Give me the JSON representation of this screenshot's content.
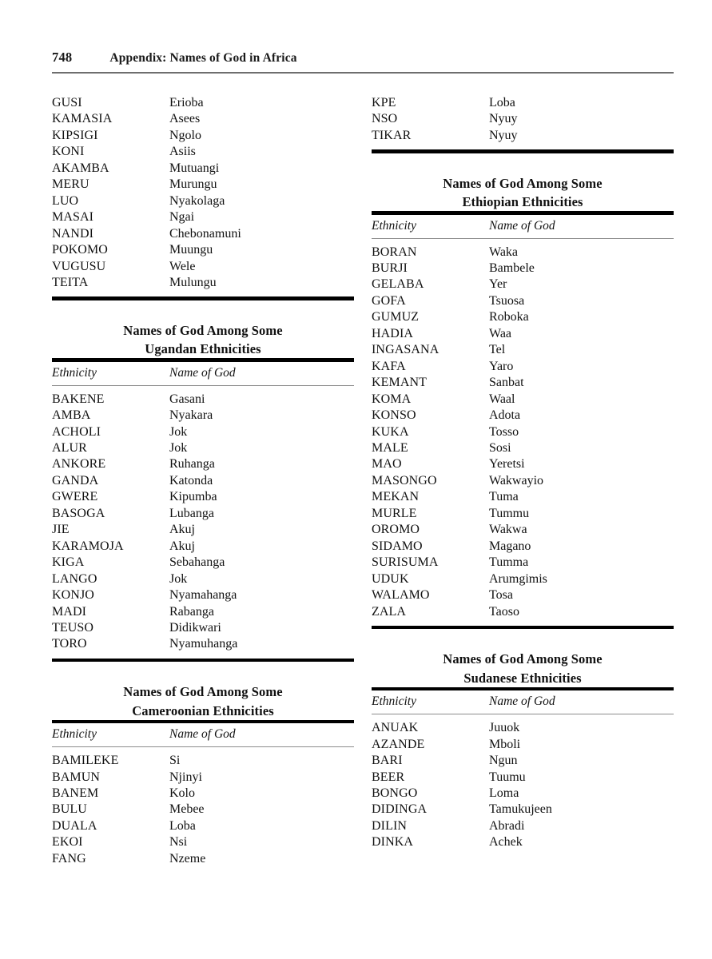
{
  "header": {
    "folio": "748",
    "title": "Appendix: Names of God in Africa"
  },
  "columns": {
    "left": [
      {
        "id": "kenyan-continued",
        "has_title": false,
        "has_column_headers": false,
        "closing_rule": true,
        "rows": [
          {
            "ethnicity": "GUSI",
            "name_of_god": "Erioba"
          },
          {
            "ethnicity": "KAMASIA",
            "name_of_god": "Asees"
          },
          {
            "ethnicity": "KIPSIGI",
            "name_of_god": "Ngolo"
          },
          {
            "ethnicity": "KONI",
            "name_of_god": "Asiis"
          },
          {
            "ethnicity": "AKAMBA",
            "name_of_god": "Mutuangi"
          },
          {
            "ethnicity": "MERU",
            "name_of_god": "Murungu"
          },
          {
            "ethnicity": "LUO",
            "name_of_god": "Nyakolaga"
          },
          {
            "ethnicity": "MASAI",
            "name_of_god": "Ngai"
          },
          {
            "ethnicity": "NANDI",
            "name_of_god": "Chebonamuni"
          },
          {
            "ethnicity": "POKOMO",
            "name_of_god": "Muungu"
          },
          {
            "ethnicity": "VUGUSU",
            "name_of_god": "Wele"
          },
          {
            "ethnicity": "TEITA",
            "name_of_god": "Mulungu"
          }
        ]
      },
      {
        "id": "ugandan",
        "has_title": true,
        "title_line1": "Names of God Among Some",
        "title_line2": "Ugandan Ethnicities",
        "has_column_headers": true,
        "header_ethnicity": "Ethnicity",
        "header_name_of_god": "Name of God",
        "closing_rule": true,
        "rows": [
          {
            "ethnicity": "BAKENE",
            "name_of_god": "Gasani"
          },
          {
            "ethnicity": "AMBA",
            "name_of_god": "Nyakara"
          },
          {
            "ethnicity": "ACHOLI",
            "name_of_god": "Jok"
          },
          {
            "ethnicity": "ALUR",
            "name_of_god": "Jok"
          },
          {
            "ethnicity": "ANKORE",
            "name_of_god": "Ruhanga"
          },
          {
            "ethnicity": "GANDA",
            "name_of_god": "Katonda"
          },
          {
            "ethnicity": "GWERE",
            "name_of_god": "Kipumba"
          },
          {
            "ethnicity": "BASOGA",
            "name_of_god": "Lubanga"
          },
          {
            "ethnicity": "JIE",
            "name_of_god": "Akuj"
          },
          {
            "ethnicity": "KARAMOJA",
            "name_of_god": "Akuj"
          },
          {
            "ethnicity": "KIGA",
            "name_of_god": "Sebahanga"
          },
          {
            "ethnicity": "LANGO",
            "name_of_god": "Jok"
          },
          {
            "ethnicity": "KONJO",
            "name_of_god": "Nyamahanga"
          },
          {
            "ethnicity": "MADI",
            "name_of_god": "Rabanga"
          },
          {
            "ethnicity": "TEUSO",
            "name_of_god": "Didikwari"
          },
          {
            "ethnicity": "TORO",
            "name_of_god": "Nyamuhanga"
          }
        ]
      },
      {
        "id": "cameroonian",
        "has_title": true,
        "title_line1": "Names of God Among Some",
        "title_line2": "Cameroonian Ethnicities",
        "has_column_headers": true,
        "header_ethnicity": "Ethnicity",
        "header_name_of_god": "Name of God",
        "closing_rule": false,
        "rows": [
          {
            "ethnicity": "BAMILEKE",
            "name_of_god": "Si"
          },
          {
            "ethnicity": "BAMUN",
            "name_of_god": "Njinyi"
          },
          {
            "ethnicity": "BANEM",
            "name_of_god": "Kolo"
          },
          {
            "ethnicity": "BULU",
            "name_of_god": "Mebee"
          },
          {
            "ethnicity": "DUALA",
            "name_of_god": "Loba"
          },
          {
            "ethnicity": "EKOI",
            "name_of_god": "Nsi"
          },
          {
            "ethnicity": "FANG",
            "name_of_god": "Nzeme"
          }
        ]
      }
    ],
    "right": [
      {
        "id": "cameroonian-continued",
        "has_title": false,
        "has_column_headers": false,
        "closing_rule": true,
        "rows": [
          {
            "ethnicity": "KPE",
            "name_of_god": "Loba"
          },
          {
            "ethnicity": "NSO",
            "name_of_god": "Nyuy"
          },
          {
            "ethnicity": "TIKAR",
            "name_of_god": "Nyuy"
          }
        ]
      },
      {
        "id": "ethiopian",
        "has_title": true,
        "title_line1": "Names of God Among Some",
        "title_line2": "Ethiopian Ethnicities",
        "has_column_headers": true,
        "header_ethnicity": "Ethnicity",
        "header_name_of_god": "Name of God",
        "closing_rule": true,
        "rows": [
          {
            "ethnicity": "BORAN",
            "name_of_god": "Waka"
          },
          {
            "ethnicity": "BURJI",
            "name_of_god": "Bambele"
          },
          {
            "ethnicity": "GELABA",
            "name_of_god": "Yer"
          },
          {
            "ethnicity": "GOFA",
            "name_of_god": "Tsuosa"
          },
          {
            "ethnicity": "GUMUZ",
            "name_of_god": "Roboka"
          },
          {
            "ethnicity": "HADIA",
            "name_of_god": "Waa"
          },
          {
            "ethnicity": "INGASANA",
            "name_of_god": "Tel"
          },
          {
            "ethnicity": "KAFA",
            "name_of_god": "Yaro"
          },
          {
            "ethnicity": "KEMANT",
            "name_of_god": "Sanbat"
          },
          {
            "ethnicity": "KOMA",
            "name_of_god": "Waal"
          },
          {
            "ethnicity": "KONSO",
            "name_of_god": "Adota"
          },
          {
            "ethnicity": "KUKA",
            "name_of_god": "Tosso"
          },
          {
            "ethnicity": "MALE",
            "name_of_god": "Sosi"
          },
          {
            "ethnicity": "MAO",
            "name_of_god": "Yeretsi"
          },
          {
            "ethnicity": "MASONGO",
            "name_of_god": "Wakwayio"
          },
          {
            "ethnicity": "MEKAN",
            "name_of_god": "Tuma"
          },
          {
            "ethnicity": "MURLE",
            "name_of_god": "Tummu"
          },
          {
            "ethnicity": "OROMO",
            "name_of_god": "Wakwa"
          },
          {
            "ethnicity": "SIDAMO",
            "name_of_god": "Magano"
          },
          {
            "ethnicity": "SURISUMA",
            "name_of_god": "Tumma"
          },
          {
            "ethnicity": "UDUK",
            "name_of_god": "Arumgimis"
          },
          {
            "ethnicity": "WALAMO",
            "name_of_god": "Tosa"
          },
          {
            "ethnicity": "ZALA",
            "name_of_god": "Taoso"
          }
        ]
      },
      {
        "id": "sudanese",
        "has_title": true,
        "title_line1": "Names of God Among Some",
        "title_line2": "Sudanese Ethnicities",
        "has_column_headers": true,
        "header_ethnicity": "Ethnicity",
        "header_name_of_god": "Name of God",
        "closing_rule": false,
        "rows": [
          {
            "ethnicity": "ANUAK",
            "name_of_god": "Juuok"
          },
          {
            "ethnicity": "AZANDE",
            "name_of_god": "Mboli"
          },
          {
            "ethnicity": "BARI",
            "name_of_god": "Ngun"
          },
          {
            "ethnicity": "BEER",
            "name_of_god": "Tuumu"
          },
          {
            "ethnicity": "BONGO",
            "name_of_god": "Loma"
          },
          {
            "ethnicity": "DIDINGA",
            "name_of_god": "Tamukujeen"
          },
          {
            "ethnicity": "DILIN",
            "name_of_god": "Abradi"
          },
          {
            "ethnicity": "DINKA",
            "name_of_god": "Achek"
          }
        ]
      }
    ]
  }
}
